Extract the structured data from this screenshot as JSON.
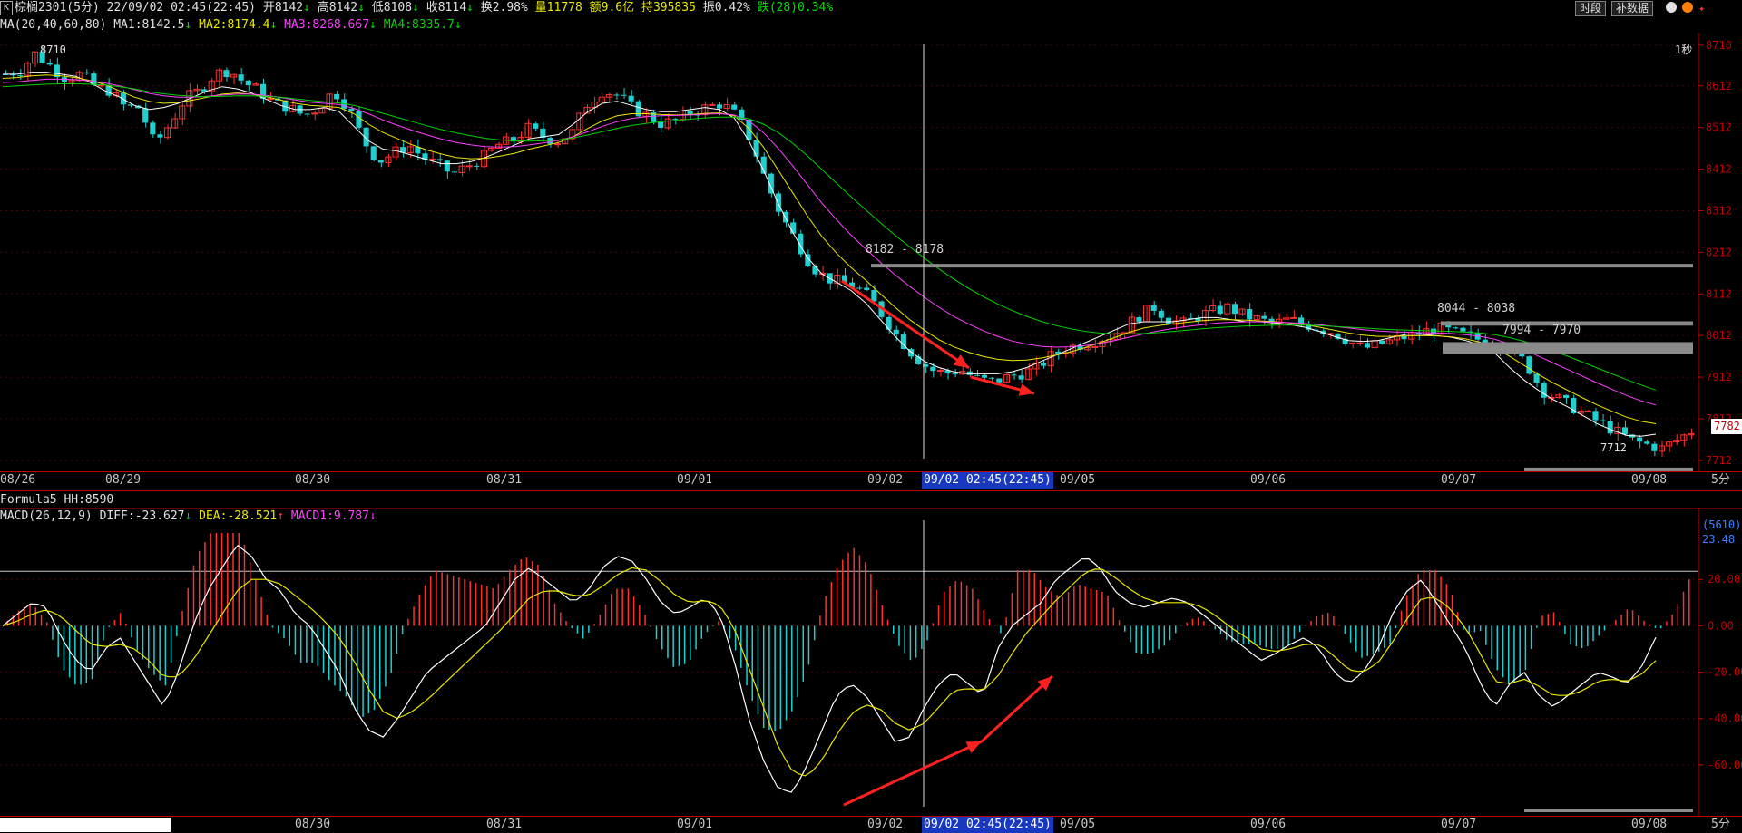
{
  "header": {
    "k_icon": "K",
    "name": "棕榈2301(5分)",
    "datetime": "22/09/02 02:45(22:45)",
    "open": "开8142",
    "open_arrow": "↓",
    "high": "高8142",
    "high_arrow": "↓",
    "low": "低8108",
    "low_arrow": "↓",
    "close": "收8114",
    "close_arrow": "↓",
    "turnover": "换2.98%",
    "volume": "量11778",
    "amount": "额9.6亿",
    "oi": "持395835",
    "amplitude": "振0.42%",
    "change": "跌(28)0.34%",
    "btn_period": "时段",
    "btn_fill": "补数据"
  },
  "ma_line": {
    "label": "MA(20,40,60,80)",
    "ma1": "MA1:8142.5",
    "ma1_arrow": "↓",
    "ma2": "MA2:8174.4",
    "ma2_arrow": "↓",
    "ma3": "MA3:8268.667",
    "ma3_arrow": "↓",
    "ma4": "MA4:8335.7",
    "ma4_arrow": "↓"
  },
  "price_panel": {
    "high_marker": "8710",
    "low_marker": "7712",
    "interval_label": "1秒",
    "current_price": "7782",
    "zone1_label": "8182 - 8178",
    "zone2_label": "8044 - 8038",
    "zone3_label": "7994 - 7970"
  },
  "formula_line": {
    "label": "Formula5 HH:8590"
  },
  "macd_line": {
    "label": "MACD(26,12,9)",
    "diff": "DIFF:-23.627",
    "diff_arrow": "↓",
    "dea": "DEA:-28.521",
    "dea_arrow": "↑",
    "macd": "MACD1:9.787",
    "macd_arrow": "↓"
  },
  "macd_panel": {
    "top_value": "(5610)",
    "level_value": "23.48"
  },
  "time_axis": {
    "labels": [
      "08/26",
      "08/29",
      "08/30",
      "08/31",
      "09/01",
      "09/02",
      "09/05",
      "09/06",
      "09/07",
      "09/08"
    ],
    "cursor_label": "09/02 02:45(22:45)",
    "period": "5分"
  },
  "colors": {
    "up": "#ff3030",
    "down": "#20d0d0",
    "ma1": "#ffffff",
    "ma2": "#e8e800",
    "ma3": "#ff40ff",
    "ma4": "#00d000",
    "frame": "#c00000",
    "arrow": "#ff2020"
  },
  "chart_data": [
    {
      "type": "candlestick",
      "title": "棕榈2301(5分)",
      "y_ticks": [
        8710,
        8612,
        8512,
        8412,
        8312,
        8212,
        8112,
        8012,
        7912,
        7812,
        7712
      ],
      "ylim": [
        7690,
        8740
      ],
      "x_labels": [
        "08/26",
        "08/29",
        "08/30",
        "08/31",
        "09/01",
        "09/02",
        "09/05",
        "09/06",
        "09/07",
        "09/08"
      ],
      "close_path": [
        8640,
        8650,
        8690,
        8660,
        8630,
        8640,
        8610,
        8600,
        8560,
        8560,
        8470,
        8520,
        8580,
        8600,
        8640,
        8650,
        8620,
        8600,
        8570,
        8560,
        8540,
        8560,
        8600,
        8560,
        8480,
        8430,
        8450,
        8470,
        8440,
        8420,
        8400,
        8420,
        8440,
        8470,
        8480,
        8510,
        8490,
        8480,
        8500,
        8570,
        8600,
        8590,
        8560,
        8540,
        8520,
        8530,
        8550,
        8560,
        8570,
        8540,
        8480,
        8380,
        8300,
        8240,
        8180,
        8150,
        8140,
        8130,
        8100,
        8050,
        8000,
        7960,
        7930,
        7920,
        7930,
        7910,
        7900,
        7910,
        7920,
        7930,
        7960,
        7980,
        7990,
        8000,
        8010,
        8030,
        8060,
        8080,
        8050,
        8040,
        8060,
        8070,
        8080,
        8060,
        8050,
        8040,
        8050,
        8040,
        8030,
        8020,
        8000,
        7980,
        7990,
        8000,
        8010,
        8020,
        8030,
        8020,
        8010,
        8000,
        7990,
        7980,
        7940,
        7880,
        7860,
        7840,
        7820,
        7800,
        7780,
        7760,
        7750,
        7740,
        7760,
        7782
      ],
      "ma_series": [
        {
          "name": "MA1",
          "values": [
            8640,
            8640,
            8645,
            8645,
            8640,
            8635,
            8620,
            8600,
            8585,
            8565,
            8555,
            8560,
            8570,
            8585,
            8600,
            8610,
            8605,
            8595,
            8580,
            8565,
            8555,
            8555,
            8560,
            8550,
            8515,
            8480,
            8460,
            8455,
            8445,
            8435,
            8425,
            8425,
            8430,
            8440,
            8455,
            8470,
            8485,
            8490,
            8495,
            8520,
            8550,
            8570,
            8575,
            8565,
            8555,
            8550,
            8550,
            8555,
            8560,
            8555,
            8535,
            8480,
            8410,
            8330,
            8260,
            8200,
            8160,
            8140,
            8120,
            8090,
            8050,
            8010,
            7975,
            7950,
            7935,
            7925,
            7920,
            7920,
            7920,
            7925,
            7935,
            7950,
            7965,
            7980,
            7995,
            8010,
            8025,
            8040,
            8045,
            8045,
            8045,
            8050,
            8055,
            8055,
            8050,
            8045,
            8045,
            8042,
            8038,
            8032,
            8022,
            8010,
            8000,
            7998,
            8000,
            8008,
            8015,
            8015,
            8012,
            8008,
            8000,
            7990,
            7970,
            7935,
            7905,
            7880,
            7858,
            7840,
            7820,
            7800,
            7785,
            7772,
            7770,
            7775
          ]
        },
        {
          "name": "MA2",
          "values": [
            8630,
            8632,
            8636,
            8638,
            8636,
            8632,
            8625,
            8615,
            8600,
            8585,
            8575,
            8570,
            8572,
            8578,
            8585,
            8592,
            8595,
            8592,
            8586,
            8578,
            8570,
            8565,
            8563,
            8560,
            8545,
            8520,
            8500,
            8485,
            8470,
            8458,
            8448,
            8440,
            8437,
            8438,
            8443,
            8450,
            8460,
            8468,
            8476,
            8490,
            8510,
            8528,
            8540,
            8545,
            8545,
            8543,
            8542,
            8543,
            8546,
            8547,
            8540,
            8510,
            8465,
            8410,
            8355,
            8300,
            8250,
            8210,
            8175,
            8145,
            8112,
            8080,
            8050,
            8025,
            8002,
            7985,
            7972,
            7962,
            7955,
            7952,
            7953,
            7958,
            7965,
            7973,
            7983,
            7995,
            8007,
            8020,
            8030,
            8036,
            8040,
            8044,
            8048,
            8050,
            8050,
            8049,
            8047,
            8045,
            8042,
            8038,
            8032,
            8025,
            8018,
            8013,
            8010,
            8010,
            8011,
            8012,
            8011,
            8009,
            8004,
            7996,
            7983,
            7962,
            7940,
            7918,
            7898,
            7880,
            7862,
            7845,
            7830,
            7816,
            7806,
            7800
          ]
        },
        {
          "name": "MA3",
          "values": [
            8620,
            8622,
            8625,
            8628,
            8628,
            8627,
            8624,
            8619,
            8612,
            8603,
            8594,
            8588,
            8585,
            8585,
            8587,
            8590,
            8592,
            8592,
            8589,
            8584,
            8578,
            8573,
            8570,
            8567,
            8558,
            8545,
            8530,
            8517,
            8505,
            8494,
            8484,
            8476,
            8470,
            8466,
            8465,
            8466,
            8470,
            8475,
            8481,
            8490,
            8502,
            8515,
            8526,
            8534,
            8538,
            8540,
            8541,
            8542,
            8544,
            8545,
            8542,
            8528,
            8500,
            8462,
            8420,
            8375,
            8330,
            8290,
            8253,
            8220,
            8188,
            8158,
            8130,
            8104,
            8080,
            8058,
            8040,
            8024,
            8010,
            7999,
            7991,
            7986,
            7984,
            7985,
            7988,
            7993,
            8000,
            8008,
            8016,
            8023,
            8029,
            8034,
            8038,
            8042,
            8044,
            8045,
            8045,
            8044,
            8043,
            8041,
            8038,
            8034,
            8030,
            8026,
            8023,
            8021,
            8020,
            8019,
            8018,
            8017,
            8014,
            8010,
            8003,
            7992,
            7978,
            7962,
            7946,
            7930,
            7914,
            7898,
            7883,
            7868,
            7855,
            7845
          ]
        },
        {
          "name": "MA4",
          "values": [
            8610,
            8612,
            8614,
            8616,
            8617,
            8617,
            8616,
            8614,
            8610,
            8605,
            8598,
            8593,
            8589,
            8587,
            8586,
            8587,
            8588,
            8588,
            8587,
            8585,
            8581,
            8577,
            8574,
            8571,
            8565,
            8556,
            8546,
            8536,
            8526,
            8516,
            8507,
            8499,
            8492,
            8486,
            8482,
            8480,
            8479,
            8480,
            8482,
            8487,
            8494,
            8502,
            8510,
            8517,
            8522,
            8526,
            8529,
            8532,
            8535,
            8537,
            8537,
            8533,
            8520,
            8500,
            8474,
            8444,
            8411,
            8378,
            8345,
            8314,
            8283,
            8253,
            8225,
            8198,
            8172,
            8148,
            8126,
            8106,
            8088,
            8072,
            8058,
            8046,
            8036,
            8028,
            8022,
            8018,
            8016,
            8016,
            8017,
            8019,
            8022,
            8025,
            8028,
            8031,
            8033,
            8035,
            8036,
            8037,
            8037,
            8037,
            8036,
            8034,
            8032,
            8030,
            8028,
            8026,
            8025,
            8024,
            8023,
            8022,
            8020,
            8018,
            8014,
            8007,
            7998,
            7987,
            7975,
            7962,
            7948,
            7934,
            7920,
            7906,
            7893,
            7881
          ]
        }
      ]
    },
    {
      "type": "macd",
      "title": "MACD(26,12,9)",
      "y_ticks": [
        20.0,
        0.0,
        -20.0,
        -40.0,
        -60.0
      ],
      "ylim": [
        -78,
        40
      ],
      "hh_level": 23.48,
      "diff": [
        0,
        5,
        10,
        8,
        -5,
        -15,
        -20,
        -10,
        -5,
        -15,
        -25,
        -35,
        -20,
        0,
        15,
        25,
        35,
        30,
        20,
        15,
        5,
        0,
        -10,
        -20,
        -35,
        -45,
        -48,
        -40,
        -30,
        -20,
        -15,
        -10,
        -5,
        0,
        10,
        20,
        25,
        20,
        15,
        10,
        15,
        25,
        30,
        28,
        20,
        10,
        5,
        8,
        12,
        5,
        -15,
        -40,
        -58,
        -70,
        -72,
        -60,
        -45,
        -30,
        -25,
        -30,
        -40,
        -50,
        -48,
        -35,
        -25,
        -20,
        -25,
        -30,
        -10,
        0,
        5,
        10,
        20,
        25,
        30,
        25,
        15,
        10,
        8,
        10,
        12,
        10,
        5,
        0,
        -5,
        -10,
        -15,
        -12,
        -8,
        -5,
        -10,
        -20,
        -25,
        -20,
        -10,
        5,
        15,
        20,
        10,
        0,
        -10,
        -25,
        -35,
        -25,
        -20,
        -30,
        -35,
        -30,
        -25,
        -20,
        -22,
        -25,
        -18,
        -5
      ],
      "dea": [
        0,
        2,
        5,
        7,
        4,
        -2,
        -8,
        -9,
        -8,
        -10,
        -15,
        -22,
        -22,
        -15,
        -5,
        5,
        15,
        20,
        20,
        18,
        13,
        8,
        2,
        -5,
        -15,
        -27,
        -37,
        -40,
        -37,
        -32,
        -26,
        -20,
        -14,
        -8,
        -2,
        5,
        12,
        15,
        15,
        13,
        13,
        17,
        22,
        25,
        24,
        19,
        13,
        10,
        11,
        9,
        -1,
        -18,
        -35,
        -52,
        -63,
        -65,
        -58,
        -47,
        -38,
        -34,
        -36,
        -42,
        -45,
        -42,
        -35,
        -28,
        -27,
        -28,
        -22,
        -12,
        -3,
        4,
        11,
        17,
        23,
        25,
        21,
        16,
        12,
        10,
        10,
        10,
        8,
        4,
        -1,
        -5,
        -10,
        -11,
        -10,
        -8,
        -8,
        -13,
        -19,
        -20,
        -16,
        -7,
        3,
        12,
        12,
        7,
        -1,
        -12,
        -24,
        -25,
        -23,
        -26,
        -30,
        -30,
        -28,
        -24,
        -23,
        -24,
        -21,
        -15
      ],
      "macd_hist": [
        0,
        6,
        10,
        2,
        -18,
        -26,
        -24,
        -2,
        6,
        -10,
        -20,
        -26,
        4,
        30,
        40,
        40,
        40,
        20,
        0,
        -6,
        -16,
        -16,
        -24,
        -30,
        -40,
        -36,
        -22,
        0,
        14,
        24,
        22,
        20,
        18,
        16,
        24,
        30,
        26,
        10,
        0,
        -6,
        4,
        16,
        16,
        6,
        -8,
        -18,
        -16,
        -4,
        2,
        -8,
        -28,
        -44,
        -46,
        -36,
        -18,
        10,
        26,
        34,
        26,
        8,
        -8,
        -16,
        -6,
        14,
        20,
        16,
        4,
        -4,
        24,
        24,
        16,
        12,
        18,
        16,
        14,
        0,
        -12,
        -12,
        -8,
        0,
        4,
        0,
        -6,
        -8,
        -8,
        -10,
        -10,
        -2,
        4,
        6,
        -4,
        -14,
        -12,
        -8,
        12,
        24,
        24,
        16,
        -4,
        -2,
        -18,
        -26,
        -20,
        4,
        6,
        -8,
        -10,
        -4,
        2,
        8,
        2,
        -2,
        6,
        20
      ]
    }
  ]
}
